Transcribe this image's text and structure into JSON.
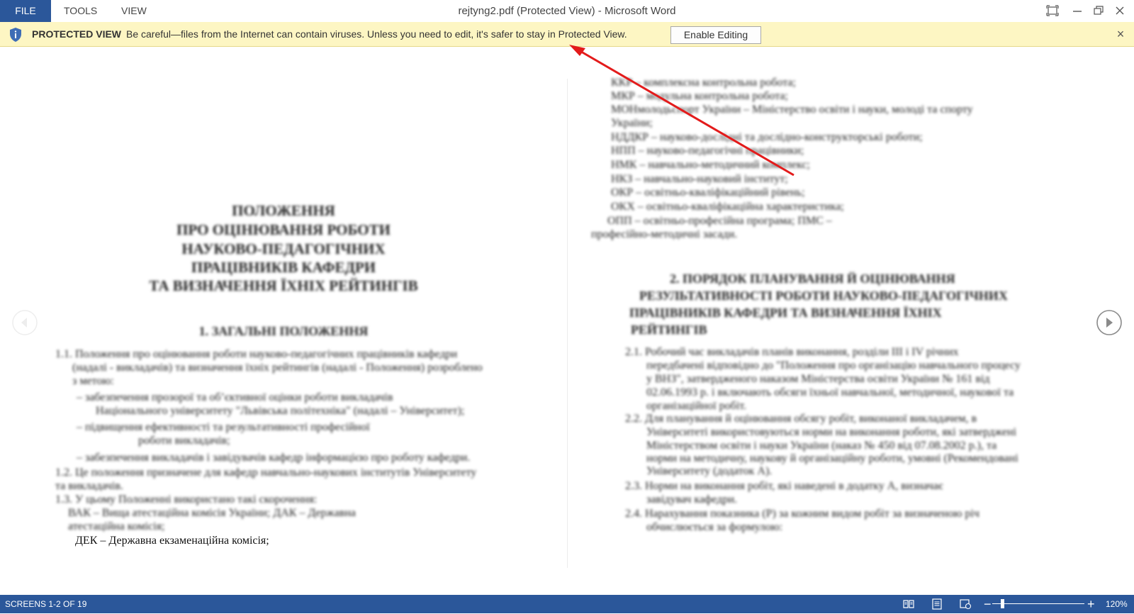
{
  "menu": {
    "file": "FILE",
    "tools": "TOOLS",
    "view": "VIEW"
  },
  "window": {
    "title": "rejtyng2.pdf (Protected View) - Microsoft Word"
  },
  "protected_view": {
    "label": "PROTECTED VIEW",
    "message": "Be careful—files from the Internet can contain viruses. Unless you need to edit, it's safer to stay in Protected View.",
    "enable_button": "Enable Editing",
    "close": "×"
  },
  "doc_left": {
    "title_lines": [
      "ПОЛОЖЕННЯ",
      "ПРО ОЦІНЮВАННЯ РОБОТИ",
      "НАУКОВО-ПЕДАГОГІЧНИХ",
      "ПРАЦІВНИКІВ КАФЕДРИ",
      "ТА ВИЗНАЧЕННЯ ЇХНІХ РЕЙТИНГІВ"
    ],
    "section_heading": "1. ЗАГАЛЬНІ ПОЛОЖЕННЯ",
    "body_lines": [
      "1.1.      Положення про оцінювання роботи науково-педагогічних працівників кафедри",
      "(надалі - викладачів) та визначення їхніх рейтингів (надалі - Положення) розроблено",
      "з метою:",
      "–   забезпечення прозорої та об’єктивної оцінки роботи викладачів",
      "Національного університету \"Львівська політехніка\" (надалі – Університет);",
      "–   підвищення ефективності та результативності професійної",
      "роботи викладачів;",
      "–   забезпечення викладачів і завідувачів кафедр інформацією про роботу кафедри.",
      "1.2.      Це положення призначене для кафедр навчально-наукових інститутів Університету",
      "та викладачів.",
      "1.3.      У цьому Положенні використано такі скорочення:",
      "ВАК – Вища атестаційна комісія України; ДАК – Державна",
      "атестаційна комісія;"
    ],
    "sharp_line": "ДЕК – Державна екзаменаційна комісія;"
  },
  "doc_right": {
    "top_lines": [
      "ККР – комплексна контрольна робота;",
      "МКР – модульна контрольна робота;",
      "МОНмолодьспорт України – Міністерство освіти і науки, молоді та спорту",
      "України;",
      "НДДКР – науково-дослідні та дослідно-конструкторські роботи;",
      "НПП – науково-педагогічні працівники;",
      "НМК – навчально-методичний комплекс;",
      "НКЗ – навчально-науковий інститут;",
      "ОКР – освітньо-кваліфікаційний рівень;",
      "ОКХ – освітньо-кваліфікаційна характеристика;",
      "ОПП   –   освітньо-професійна   програма;   ПМС   –",
      "професійно-методичні засади."
    ],
    "section_lines": [
      "2. ПОРЯДОК ПЛАНУВАННЯ Й ОЦІНЮВАННЯ",
      "РЕЗУЛЬТАТИВНОСТІ РОБОТИ НАУКОВО-ПЕДАГОГІЧНИХ",
      "ПРАЦІВНИКІВ КАФЕДРИ ТА ВИЗНАЧЕННЯ ЇХНІХ",
      "РЕЙТИНГІВ"
    ],
    "body_lines": [
      "2.1.      Робочий час викладачів планів виконання, розділи ІІІ і IV річних",
      "передбачені відповідно до \"Положення про організацію навчального процесу",
      "у ВНЗ\", затвердженого наказом Міністерства освіти України № 161 від",
      "02.06.1993 р. і включають обсяги їхньої навчальної, методичної, наукової та",
      "організаційної робіт.",
      "2.2.      Для планування й оцінювання обсягу робіт, виконаної викладачем, в",
      "Університеті використовуються норми на виконання роботи, які затверджені",
      "Міністерством освіти і науки України (наказ № 450 від 07.08.2002 р.), та",
      "норми на методичну, наукову й організаційну роботи, умовні (Рекомендовані",
      "Університету (додаток А).",
      "2.3.      Норми на виконання робіт, які наведені в додатку А, визначає",
      "завідувач кафедри.",
      "2.4.      Нарахування показника (Р) за кожним видом робіт за визначеною річ",
      "обчислюється за формулою:"
    ]
  },
  "status": {
    "screens": "SCREENS 1-2 OF 19",
    "zoom": "120%",
    "zoom_minus": "−",
    "zoom_plus": "+"
  },
  "icons": {
    "shield": "shield-info-icon",
    "close": "close-icon",
    "fullscreen": "full-screen-icon",
    "minimize": "minimize-icon",
    "restore": "restore-icon",
    "window_close": "window-close-icon",
    "next": "next-page-icon",
    "prev": "previous-page-icon",
    "read_mode": "read-mode-icon",
    "print_layout": "print-layout-icon",
    "web_layout": "web-layout-icon"
  },
  "colors": {
    "accent": "#2b579a",
    "protected_bar": "#fdf6c3",
    "annotation_arrow": "#e31b1b"
  }
}
